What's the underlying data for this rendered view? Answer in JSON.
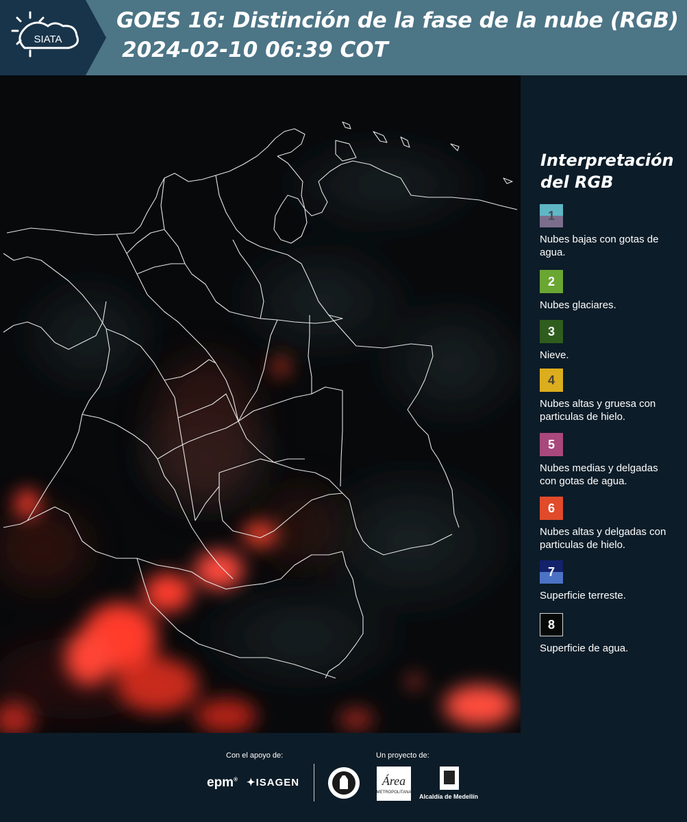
{
  "header": {
    "logo_text": "SIATA",
    "title_line1": "GOES 16: Distinción de la fase de la nube (RGB)",
    "title_line2": "2024-02-10 06:39 COT",
    "bg_color": "#4c7586"
  },
  "legend": {
    "title": "Interpretación del RGB",
    "items": [
      {
        "number": "1",
        "label": "Nubes bajas con gotas de agua.",
        "color_top": "#5fb7c6",
        "color_bottom": "#7a6e8c",
        "num_color": "#4a4a55"
      },
      {
        "number": "2",
        "label": "Nubes glaciares.",
        "color_top": "#6aa632",
        "color_bottom": "#6aa632",
        "num_color": "#ffffff"
      },
      {
        "number": "3",
        "label": "Nieve.",
        "color_top": "#2f5d1e",
        "color_bottom": "#2f5d1e",
        "num_color": "#ffffff"
      },
      {
        "number": "4",
        "label": "Nubes altas y gruesa con particulas de hielo.",
        "color_top": "#dcae1d",
        "color_bottom": "#dcae1d",
        "num_color": "#4a4030"
      },
      {
        "number": "5",
        "label": "Nubes medias y delgadas con gotas de agua.",
        "color_top": "#a9487c",
        "color_bottom": "#a9487c",
        "num_color": "#ffffff"
      },
      {
        "number": "6",
        "label": "Nubes altas y delgadas con particulas de hielo.",
        "color_top": "#e14a2a",
        "color_bottom": "#e14a2a",
        "num_color": "#ffffff"
      },
      {
        "number": "7",
        "label": "Superficie terreste.",
        "color_top": "#13226a",
        "color_bottom": "#4c72c6",
        "num_color": "#ffffff"
      },
      {
        "number": "8",
        "label": "Superficie de agua.",
        "color_top": "#050a08",
        "color_bottom": "#050a08",
        "num_color": "#ffffff"
      }
    ]
  },
  "footer": {
    "support_label": "Con el apoyo de:",
    "project_label": "Un proyecto de:",
    "epm": "epm",
    "isagen": "ISAGEN",
    "area_text": "Área",
    "area_subtext": "METROPOLITANA",
    "alcaldia": "Alcaldía de Medellín"
  }
}
